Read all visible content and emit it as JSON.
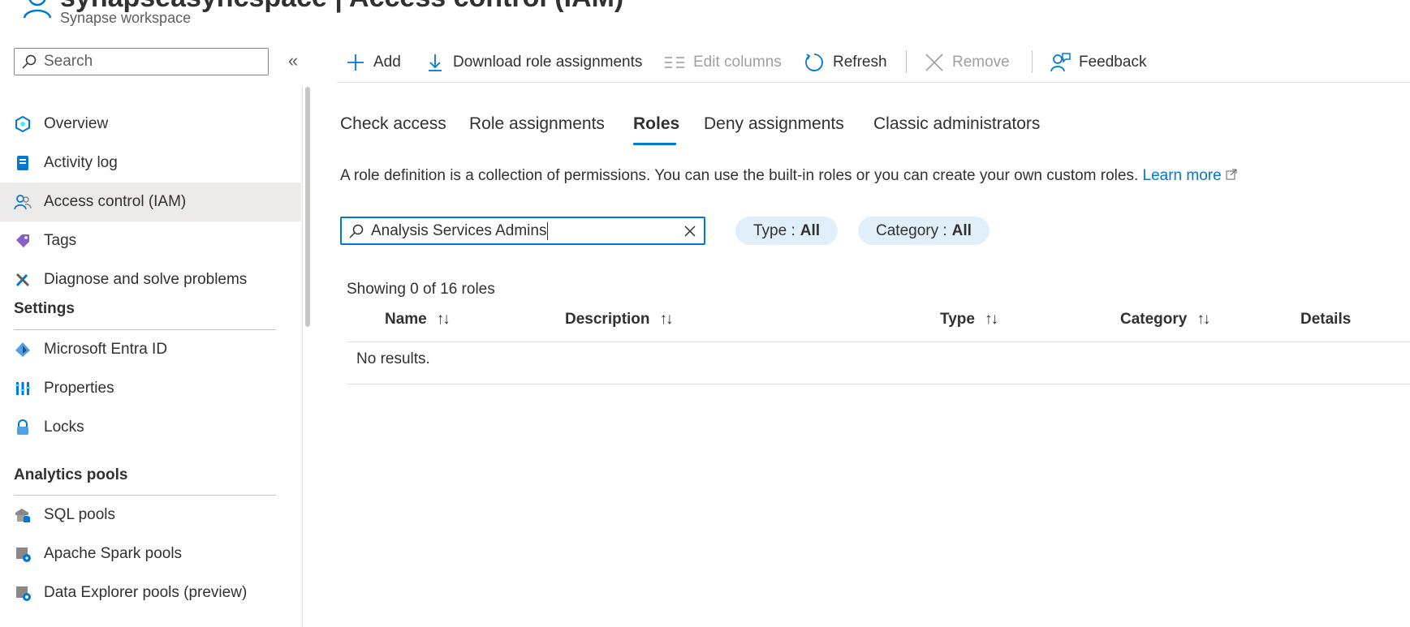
{
  "header": {
    "title": "synapseasyncspace | Access control (IAM)",
    "subtitle": "Synapse workspace"
  },
  "sidebar": {
    "search_placeholder": "Search",
    "items": [
      {
        "label": "Overview",
        "icon": "overview-icon"
      },
      {
        "label": "Activity log",
        "icon": "activity-log-icon"
      },
      {
        "label": "Access control (IAM)",
        "icon": "people-icon",
        "active": true
      },
      {
        "label": "Tags",
        "icon": "tag-icon"
      },
      {
        "label": "Diagnose and solve problems",
        "icon": "wrench-icon"
      }
    ],
    "settings_header": "Settings",
    "settings_items": [
      {
        "label": "Microsoft Entra ID",
        "icon": "entra-icon"
      },
      {
        "label": "Properties",
        "icon": "properties-icon"
      },
      {
        "label": "Locks",
        "icon": "lock-icon"
      }
    ],
    "analytics_header": "Analytics pools",
    "analytics_items": [
      {
        "label": "SQL pools",
        "icon": "sql-pool-icon"
      },
      {
        "label": "Apache Spark pools",
        "icon": "spark-pool-icon"
      },
      {
        "label": "Data Explorer pools (preview)",
        "icon": "data-explorer-icon"
      }
    ]
  },
  "toolbar": {
    "add": "Add",
    "download": "Download role assignments",
    "edit_columns": "Edit columns",
    "refresh": "Refresh",
    "remove": "Remove",
    "feedback": "Feedback"
  },
  "tabs": [
    {
      "label": "Check access"
    },
    {
      "label": "Role assignments"
    },
    {
      "label": "Roles",
      "selected": true
    },
    {
      "label": "Deny assignments"
    },
    {
      "label": "Classic administrators"
    }
  ],
  "description": {
    "text": "A role definition is a collection of permissions. You can use the built-in roles or you can create your own custom roles.",
    "link": "Learn more"
  },
  "filter": {
    "value": "Analysis Services Admins",
    "type_label": "Type :",
    "type_value": "All",
    "category_label": "Category :",
    "category_value": "All"
  },
  "table": {
    "showing": "Showing 0 of 16 roles",
    "columns": [
      "Name",
      "Description",
      "Type",
      "Category",
      "Details"
    ],
    "empty": "No results."
  },
  "colors": {
    "accent": "#0078d4",
    "pill_bg": "#e1effa",
    "active_nav_bg": "#edebe9"
  }
}
